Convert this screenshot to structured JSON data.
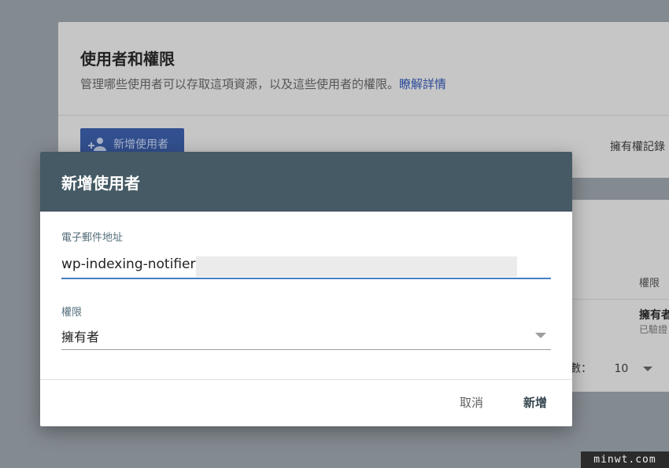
{
  "background": {
    "card_title": "使用者和權限",
    "card_desc": "管理哪些使用者可以存取這項資源，以及這些使用者的權限。",
    "card_link": "瞭解詳情",
    "add_user_button": "新增使用者",
    "owner_record_label": "擁有權記錄",
    "table_perm_header": "權限",
    "row_perm_value": "擁有者",
    "row_perm_sub": "已驗證",
    "rows_per_page_label": "數：",
    "rows_per_page_value": "10"
  },
  "dialog": {
    "title": "新增使用者",
    "email_label": "電子郵件地址",
    "email_value": "wp-indexing-notifier@",
    "permission_label": "權限",
    "permission_value": "擁有者",
    "cancel_label": "取消",
    "add_label": "新增"
  },
  "watermark": "minwt.com",
  "colors": {
    "dialog_header": "#455a64",
    "input_focus": "#4a7ec2",
    "primary_button": "#32508f"
  }
}
